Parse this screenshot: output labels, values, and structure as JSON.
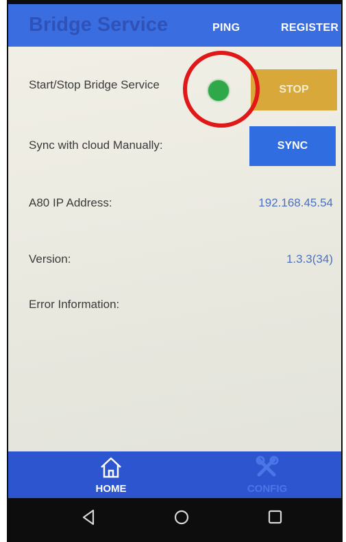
{
  "appbar": {
    "title": "Bridge Service",
    "ping_label": "PING",
    "register_label": "REGISTER"
  },
  "rows": {
    "service": {
      "label": "Start/Stop Bridge Service",
      "status": "running",
      "button_label": "STOP"
    },
    "sync": {
      "label": "Sync with cloud Manually:",
      "button_label": "SYNC"
    },
    "ip": {
      "label": "A80 IP Address:",
      "value": "192.168.45.54"
    },
    "version": {
      "label": "Version:",
      "value": "1.3.3(34)"
    },
    "error": {
      "label": "Error Information:",
      "value": ""
    }
  },
  "bottom_nav": {
    "items": [
      {
        "label": "HOME",
        "icon": "home-icon",
        "active": true
      },
      {
        "label": "CONFIG",
        "icon": "tools-icon",
        "active": false
      }
    ]
  },
  "system_nav": {
    "icons": [
      "back-icon",
      "home-circle-icon",
      "recents-icon"
    ]
  },
  "colors": {
    "appbar": "#3a6ee0",
    "title": "#2f52b8",
    "stop_button": "#d8a93a",
    "sync_button": "#2f6de0",
    "status_dot": "#2fa84a",
    "bottom_nav": "#2c55cf",
    "annotation": "#e01818"
  }
}
